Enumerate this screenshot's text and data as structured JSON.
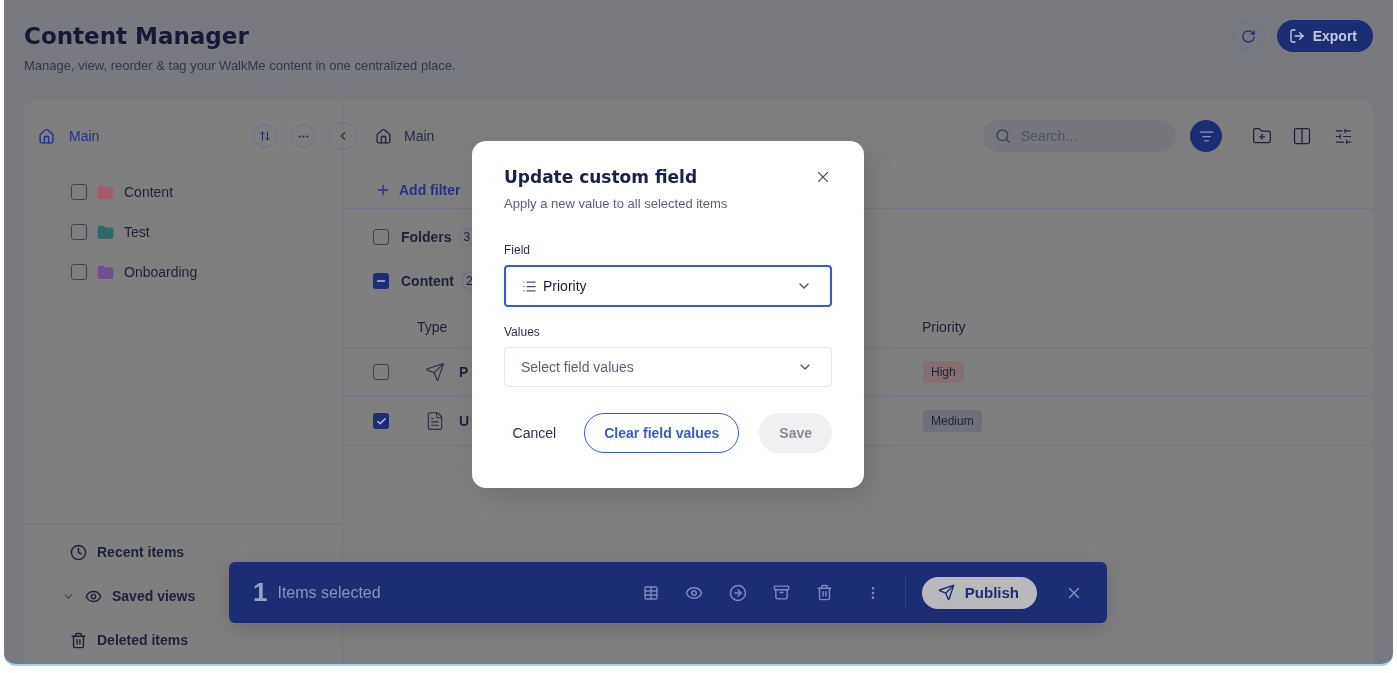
{
  "header": {
    "title": "Content Manager",
    "subtitle": "Manage, view, reorder & tag your WalkMe content in one centralized place.",
    "export_label": "Export"
  },
  "sidebar": {
    "root": "Main",
    "folders": [
      {
        "name": "Content",
        "color": "#a25c6c",
        "checked": false
      },
      {
        "name": "Test",
        "color": "#2e6a6a",
        "checked": false
      },
      {
        "name": "Onboarding",
        "color": "#70508c",
        "checked": false
      }
    ],
    "nav": [
      {
        "label": "Recent items",
        "kind": "recent"
      },
      {
        "label": "Saved views",
        "kind": "views"
      },
      {
        "label": "Deleted items",
        "kind": "deleted"
      }
    ]
  },
  "main": {
    "breadcrumb": "Main",
    "search": {
      "placeholder": "Search..."
    },
    "add_filter": "Add filter",
    "groups": [
      {
        "label": "Folders",
        "count": "3",
        "partial": false
      },
      {
        "label": "Content",
        "count": "2",
        "partial": true
      }
    ],
    "columns": {
      "type": "Type",
      "priority": "Priority"
    },
    "rows": [
      {
        "kind": "send",
        "name": "P",
        "checked": false,
        "priority": "High",
        "color": "#857071"
      },
      {
        "kind": "doc",
        "name": "U",
        "checked": true,
        "priority": "Medium",
        "color": "#6f7079"
      }
    ]
  },
  "selection_bar": {
    "count": "1",
    "label": "Items selected",
    "publish": "Publish"
  },
  "modal": {
    "title": "Update custom field",
    "subtitle": "Apply a new value to all selected items",
    "field_label": "Field",
    "field_value": "Priority",
    "values_label": "Values",
    "values_placeholder": "Select field values",
    "cancel": "Cancel",
    "clear": "Clear field values",
    "save": "Save",
    "save_disabled": true
  }
}
